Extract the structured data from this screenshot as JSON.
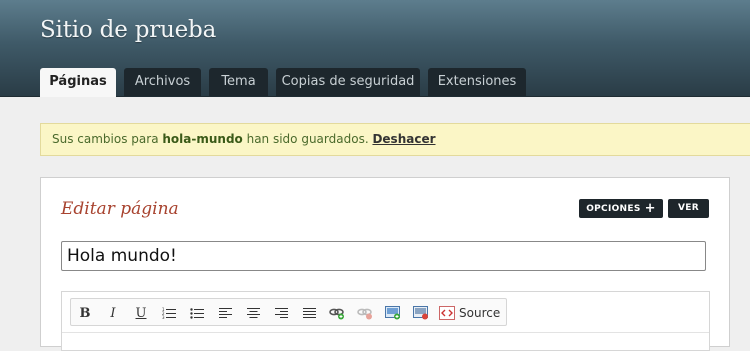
{
  "site": {
    "title": "Sitio de prueba"
  },
  "tabs": [
    {
      "label": "Páginas",
      "active": true
    },
    {
      "label": "Archivos",
      "active": false
    },
    {
      "label": "Tema",
      "active": false
    },
    {
      "label": "Copias de seguridad",
      "active": false
    },
    {
      "label": "Extensiones",
      "active": false
    }
  ],
  "notice": {
    "prefix": "Sus cambios para ",
    "page_name": "hola-mundo",
    "suffix": " han sido guardados. ",
    "undo_label": "Deshacer"
  },
  "panel": {
    "title": "Editar página",
    "options_label": "OPCIONES",
    "view_label": "VER"
  },
  "page_title_field": {
    "value": "Hola mundo!"
  },
  "editor": {
    "source_label": "Source",
    "tools": [
      "bold-icon",
      "italic-icon",
      "underline-icon",
      "numbered-list-icon",
      "bullet-list-icon",
      "align-left-icon",
      "align-center-icon",
      "align-right-icon",
      "align-justify-icon",
      "link-icon",
      "unlink-icon",
      "image-icon",
      "flash-icon",
      "source-icon"
    ]
  },
  "colors": {
    "header_dark": "#2a3c46",
    "tab_dark": "#1d272d",
    "notice_bg": "#fbf6c6",
    "title_accent": "#a8432f"
  }
}
